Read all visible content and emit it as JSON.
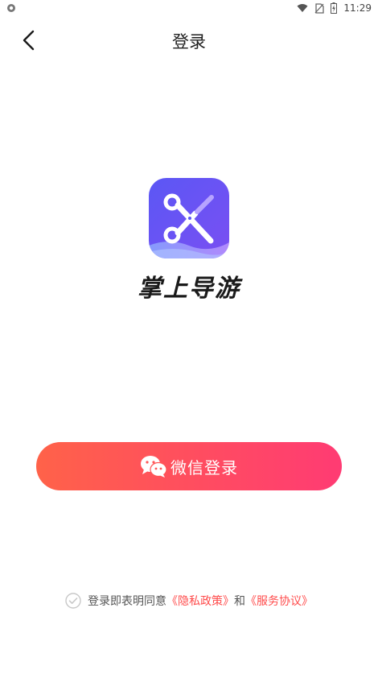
{
  "status_bar": {
    "time": "11:29",
    "icons": [
      "notification-icon",
      "wifi-icon",
      "no-sim-icon",
      "battery-charging-icon"
    ]
  },
  "nav": {
    "title": "登录",
    "back_icon": "chevron-left-icon"
  },
  "app": {
    "name": "掌上导游",
    "logo_icon": "scissors-icon"
  },
  "login": {
    "wechat_label": "微信登录",
    "wechat_icon": "wechat-icon"
  },
  "agreement": {
    "text": "登录即表明同意",
    "privacy_link": "《隐私政策》",
    "conjunction": "和",
    "service_link": "《服务协议》",
    "checked": false
  },
  "colors": {
    "button_gradient_start": "#ff6249",
    "button_gradient_end": "#ff3b73",
    "link": "#ff4b4b",
    "logo_gradient_start": "#5b57f5",
    "logo_gradient_end": "#7a4ff2"
  }
}
